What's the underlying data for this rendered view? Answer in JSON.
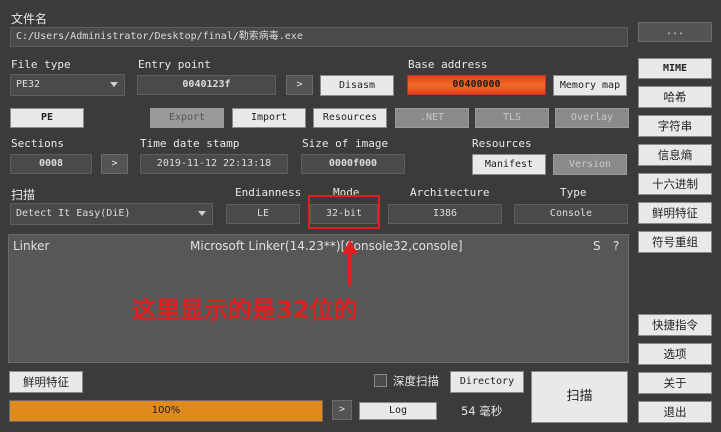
{
  "file": {
    "label": "文件名",
    "path": "C:/Users/Administrator/Desktop/final/勒索病毒.exe",
    "browse": "..."
  },
  "file_type": {
    "label": "File type",
    "value": "PE32"
  },
  "entry_point": {
    "label": "Entry point",
    "value": "0040123f",
    "go": ">",
    "disasm": "Disasm"
  },
  "base_address": {
    "label": "Base address",
    "value": "00400000",
    "memory_map": "Memory map"
  },
  "pe_button": "PE",
  "toolbar": {
    "export": "Export",
    "import": "Import",
    "resources": "Resources",
    "net": ".NET",
    "tls": "TLS",
    "overlay": "Overlay"
  },
  "sections": {
    "label": "Sections",
    "value": "0008",
    "go": ">"
  },
  "time_date_stamp": {
    "label": "Time date stamp",
    "value": "2019-11-12 22:13:18"
  },
  "size_of_image": {
    "label": "Size of image",
    "value": "0000f000"
  },
  "resources_group": {
    "label": "Resources",
    "manifest": "Manifest",
    "version": "Version"
  },
  "scan": {
    "label": "扫描",
    "engine": "Detect It Easy(DiE)"
  },
  "endianness": {
    "label": "Endianness",
    "value": "LE"
  },
  "mode": {
    "label": "Mode",
    "value": "32-bit"
  },
  "architecture": {
    "label": "Architecture",
    "value": "I386"
  },
  "type": {
    "label": "Type",
    "value": "Console"
  },
  "result": {
    "kind": "Linker",
    "name": "Microsoft Linker(14.23**)[Console32,console]",
    "s": "S",
    "q": "?"
  },
  "annotation": {
    "text": "这里显示的是32位的",
    "color": "#e02020"
  },
  "right_panel": {
    "mime": "MIME",
    "hash": "哈希",
    "strings": "字符串",
    "entropy": "信息熵",
    "hex": "十六进制",
    "signatures": "鲜明特征",
    "symbols": "符号重组",
    "shortcuts": "快捷指令",
    "options": "选项",
    "about": "关于",
    "exit": "退出"
  },
  "bottom": {
    "signatures": "鲜明特征",
    "deep_scan": "深度扫描",
    "directory": "Directory",
    "progress_text": "100%",
    "progress": 1.0,
    "go": ">",
    "log": "Log",
    "time": "54 毫秒",
    "scan_button": "扫描"
  },
  "colors": {
    "progress": "#e08a1e",
    "base_address": "#e8501a"
  }
}
